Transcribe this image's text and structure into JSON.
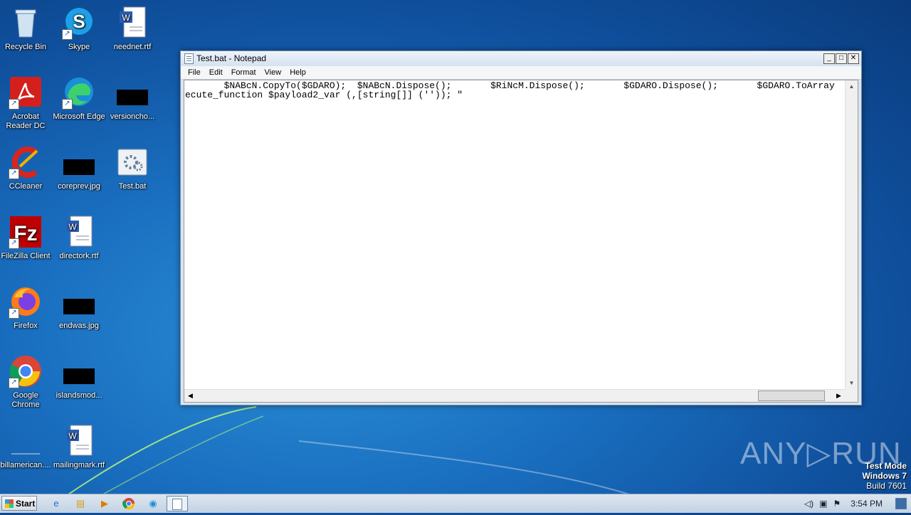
{
  "desktop": {
    "icons": [
      {
        "label": "Recycle Bin",
        "icon": "recycle-bin-icon"
      },
      {
        "label": "Skype",
        "icon": "skype-icon"
      },
      {
        "label": "neednet.rtf",
        "icon": "word-document-icon"
      },
      {
        "label": "Acrobat Reader DC",
        "icon": "acrobat-icon"
      },
      {
        "label": "Microsoft Edge",
        "icon": "edge-icon"
      },
      {
        "label": "versioncho...",
        "icon": "black-image-icon"
      },
      {
        "label": "CCleaner",
        "icon": "ccleaner-icon"
      },
      {
        "label": "coreprev.jpg",
        "icon": "black-image-icon"
      },
      {
        "label": "Test.bat",
        "icon": "batch-file-icon"
      },
      {
        "label": "FileZilla Client",
        "icon": "filezilla-icon"
      },
      {
        "label": "directork.rtf",
        "icon": "word-document-icon"
      },
      {
        "label": "Firefox",
        "icon": "firefox-icon"
      },
      {
        "label": "endwas.jpg",
        "icon": "black-image-icon"
      },
      {
        "label": "Google Chrome",
        "icon": "chrome-icon"
      },
      {
        "label": "islandsmod...",
        "icon": "black-image-icon"
      },
      {
        "label": "billamerican....",
        "icon": "blank-file-icon"
      },
      {
        "label": "mailingmark.rtf",
        "icon": "word-document-icon"
      }
    ]
  },
  "notepad": {
    "title": "Test.bat - Notepad",
    "menu": [
      "File",
      "Edit",
      "Format",
      "View",
      "Help"
    ],
    "lines": [
      "       $NABcN.CopyTo($GDARO);  $NABcN.Dispose();       $RiNcM.Dispose();       $GDARO.Dispose();       $GDARO.ToArray",
      "ecute_function $payload2_var (,[string[]] ('')); \""
    ],
    "buttons": {
      "minimize": "_",
      "maximize": "□",
      "close": "✕"
    }
  },
  "watermark": {
    "brand": "ANY▷RUN",
    "mode_line1": "Test Mode",
    "mode_line2": "Windows 7",
    "mode_line3": "Build 7601"
  },
  "taskbar": {
    "start_label": "Start",
    "items": [
      "internet-explorer-icon",
      "file-explorer-icon",
      "media-player-icon",
      "chrome-icon",
      "edge-icon",
      "notepad-icon"
    ],
    "clock": "3:54 PM"
  }
}
